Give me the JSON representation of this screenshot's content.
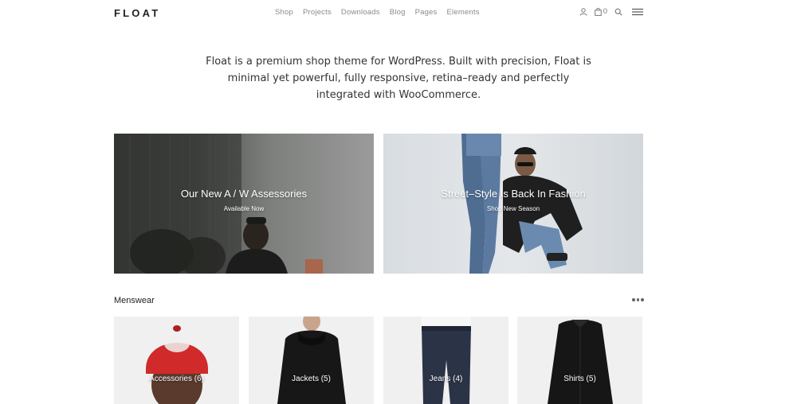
{
  "header": {
    "logo": "FLOAT",
    "nav": [
      "Shop",
      "Projects",
      "Downloads",
      "Blog",
      "Pages",
      "Elements"
    ],
    "cart_count": "0",
    "icons": [
      "user-icon",
      "bag-icon",
      "search-icon",
      "menu-icon"
    ]
  },
  "intro": {
    "lines": [
      "Float is a premium shop theme for WordPress. Built with precision, Float is",
      "minimal yet powerful, fully responsive, retina–ready and perfectly",
      "integrated with WooCommerce."
    ]
  },
  "banners": [
    {
      "title": "Our New A / W Assessories",
      "subtitle": "Available Now"
    },
    {
      "title": "Street–Style Is Back In Fashion",
      "subtitle": "Shop New Season"
    }
  ],
  "section": {
    "title": "Menswear"
  },
  "products": [
    {
      "label": "Accessories (6)"
    },
    {
      "label": "Jackets (5)"
    },
    {
      "label": "Jeans (4)"
    },
    {
      "label": "Shirts (5)"
    }
  ],
  "colors": {
    "text": "#222222",
    "nav": "#8a8a8a",
    "tile_bg": "#f0f0f0"
  }
}
